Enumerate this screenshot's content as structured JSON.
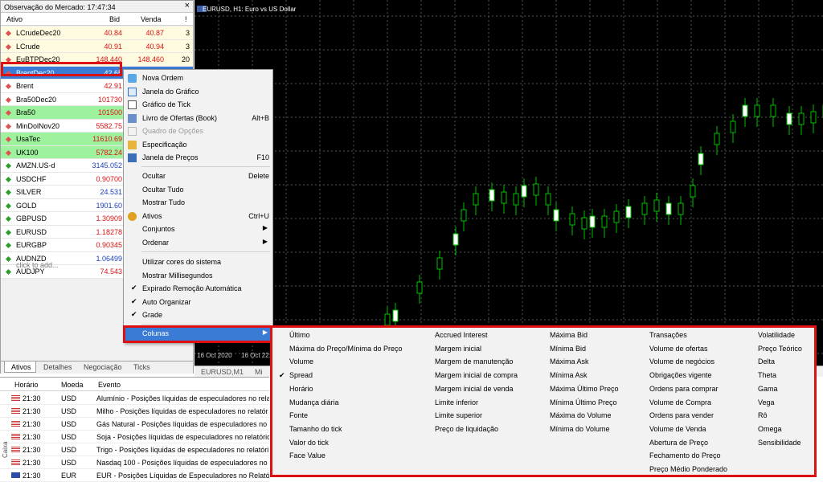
{
  "market_watch": {
    "title": "Observação do Mercado: 17:47:34",
    "close": "×",
    "columns": {
      "symbol": "Ativo",
      "bid": "Bid",
      "ask": "Venda",
      "spread": "!"
    },
    "rows": [
      {
        "symbol": "LCrudeDec20",
        "bid": "40.84",
        "ask": "40.87",
        "spread": "3"
      },
      {
        "symbol": "LCrude",
        "bid": "40.91",
        "ask": "40.94",
        "spread": "3"
      },
      {
        "symbol": "EuBTPDec20",
        "bid": "148.440",
        "ask": "148.460",
        "spread": "20"
      },
      {
        "symbol": "BrentDec20",
        "bid": "42.65",
        "ask": "",
        "spread": ""
      },
      {
        "symbol": "Brent",
        "bid": "42.91",
        "ask": "",
        "spread": ""
      },
      {
        "symbol": "Bra50Dec20",
        "bid": "101730",
        "ask": "",
        "spread": ""
      },
      {
        "symbol": "Bra50",
        "bid": "101500",
        "ask": "",
        "spread": ""
      },
      {
        "symbol": "MinDolNov20",
        "bid": "5582.75",
        "ask": "",
        "spread": ""
      },
      {
        "symbol": "UsaTec",
        "bid": "11610.69",
        "ask": "",
        "spread": ""
      },
      {
        "symbol": "UK100",
        "bid": "5782.24",
        "ask": "",
        "spread": ""
      },
      {
        "symbol": "AMZN.US-d",
        "bid": "3145.052",
        "ask": "",
        "spread": ""
      },
      {
        "symbol": "USDCHF",
        "bid": "0.90700",
        "ask": "",
        "spread": ""
      },
      {
        "symbol": "SILVER",
        "bid": "24.531",
        "ask": "",
        "spread": ""
      },
      {
        "symbol": "GOLD",
        "bid": "1901.60",
        "ask": "",
        "spread": ""
      },
      {
        "symbol": "GBPUSD",
        "bid": "1.30909",
        "ask": "",
        "spread": ""
      },
      {
        "symbol": "EURUSD",
        "bid": "1.18278",
        "ask": "",
        "spread": ""
      },
      {
        "symbol": "EURGBP",
        "bid": "0.90345",
        "ask": "",
        "spread": ""
      },
      {
        "symbol": "AUDNZD",
        "bid": "1.06499",
        "ask": "",
        "spread": ""
      },
      {
        "symbol": "AUDJPY",
        "bid": "74.543",
        "ask": "",
        "spread": ""
      }
    ],
    "add_hint": "click to add...",
    "tabs": [
      "Ativos",
      "Detalhes",
      "Negociação",
      "Ticks"
    ]
  },
  "chart": {
    "title": "EURUSD, H1: Euro vs US Dollar",
    "date_labels": [
      "16 Oct 2020",
      "16 Oct 22:00"
    ],
    "tabs": [
      "EURUSD,M1",
      "Mi"
    ]
  },
  "calendar": {
    "columns": {
      "time": "Horário",
      "currency": "Moeda",
      "event": "Evento"
    },
    "rows": [
      {
        "time": "21:30",
        "currency": "USD",
        "event": "Alumínio - Posições líquidas de especuladores no rela"
      },
      {
        "time": "21:30",
        "currency": "USD",
        "event": "Milho - Posições líquidas de especuladores no relatór"
      },
      {
        "time": "21:30",
        "currency": "USD",
        "event": "Gás Natural - Posições líquidas de especuladores no r"
      },
      {
        "time": "21:30",
        "currency": "USD",
        "event": "Soja - Posições líquidas de especuladores no relatório"
      },
      {
        "time": "21:30",
        "currency": "USD",
        "event": "Trigo - Posições líquidas de especuladores no relatóri"
      },
      {
        "time": "21:30",
        "currency": "USD",
        "event": "Nasdaq 100 - Posições líquidas de especuladores no r"
      },
      {
        "time": "21:30",
        "currency": "EUR",
        "event": "EUR - Posições Líquidas de Especuladores no Relatór"
      }
    ],
    "side_label": "Caixa"
  },
  "context_menu": {
    "items": {
      "nova_ordem": "Nova Ordem",
      "janela_grafico": "Janela do Gráfico",
      "grafico_tick": "Gráfico de Tick",
      "livro_ofertas": "Livro de Ofertas (Book)",
      "livro_ofertas_sc": "Alt+B",
      "quadro_opcoes": "Quadro de Opções",
      "especificacao": "Especificação",
      "janela_precos": "Janela de Preços",
      "janela_precos_sc": "F10",
      "ocultar": "Ocultar",
      "ocultar_sc": "Delete",
      "ocultar_tudo": "Ocultar Tudo",
      "mostrar_tudo": "Mostrar Tudo",
      "ativos": "Ativos",
      "ativos_sc": "Ctrl+U",
      "conjuntos": "Conjuntos",
      "ordenar": "Ordenar",
      "cores_sistema": "Utilizar cores do sistema",
      "mostrar_ms": "Mostrar Millisegundos",
      "expirado": "Expirado Remoção Automática",
      "auto_organizar": "Auto Organizar",
      "grade": "Grade",
      "colunas": "Colunas"
    }
  },
  "submenu": {
    "col1": [
      "Último",
      "Máxima do Preço/Mínima do Preço",
      "Volume",
      "Spread",
      "Horário",
      "Mudança diária",
      "Fonte",
      "Tamanho do tick",
      "Valor do tick",
      "Face Value"
    ],
    "col2": [
      "Accrued Interest",
      "Margem inicial",
      "Margem de manutenção",
      "Margem inicial de compra",
      "Margem inicial de venda",
      "Limite inferior",
      "Limite superior",
      "Preço de liquidação"
    ],
    "col3": [
      "Máxima Bid",
      "Mínima Bid",
      "Máxima Ask",
      "Mínima Ask",
      "Máxima Último Preço",
      "Mínima Último Preço",
      "Máxima do Volume",
      "Mínima do Volume"
    ],
    "col4": [
      "Transações",
      "Volume de ofertas",
      "Volume de negócios",
      "Obrigações vigente",
      "Ordens para comprar",
      "Volume de Compra",
      "Ordens para vender",
      "Volume de Venda",
      "Abertura de Preço",
      "Fechamento do Preço",
      "Preço Médio Ponderado"
    ],
    "col5": [
      "Volatilidade",
      "Preço Teórico",
      "Delta",
      "Theta",
      "Gama",
      "Vega",
      "Rô",
      "Omega",
      "Sensibilidade"
    ]
  },
  "colors": {
    "accent": "#d11",
    "menu_highlight": "#3a7bd5",
    "bid_red": "#d11",
    "bid_blue": "#1a3fbf",
    "candle_up": "#00c000"
  }
}
